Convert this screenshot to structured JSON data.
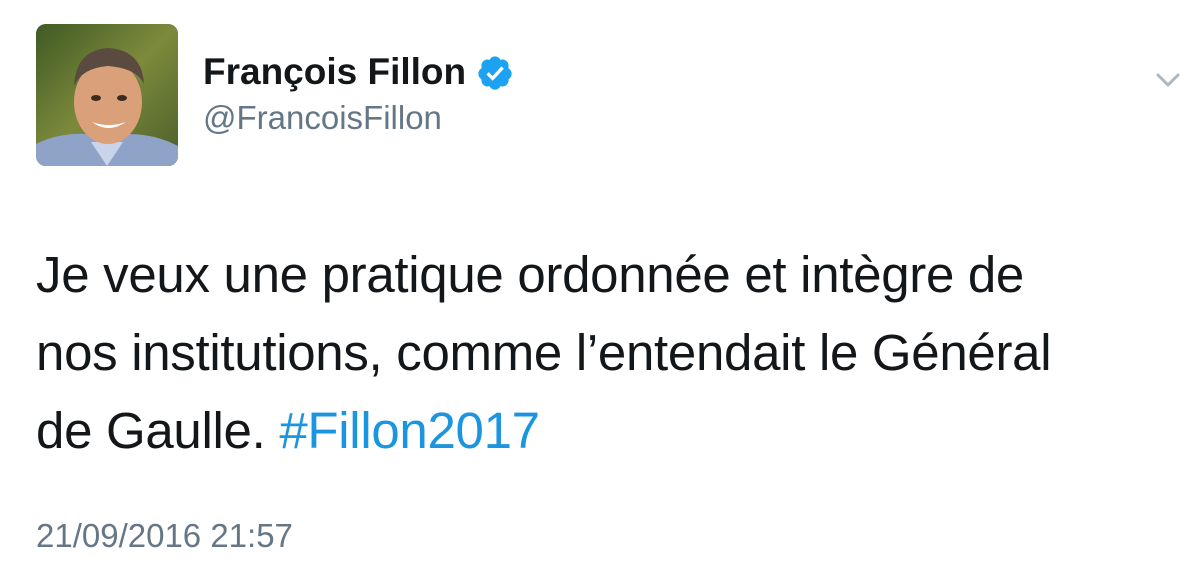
{
  "author": {
    "display_name": "François Fillon",
    "handle": "@FrancoisFillon",
    "verified": true
  },
  "tweet": {
    "line1": "Je veux une pratique ordonnée et intègre de",
    "line2": "nos institutions, comme l’entendait le Général",
    "line3_text": "de Gaulle. ",
    "hashtag": "#Fillon2017",
    "timestamp": "21/09/2016 21:57"
  },
  "icons": {
    "verified": "verified-badge-icon",
    "menu": "chevron-down-icon"
  },
  "colors": {
    "text": "#14171a",
    "secondary": "#657786",
    "link": "#1b95e0",
    "verified": "#1da1f2",
    "chevron": "#aab8c2"
  }
}
